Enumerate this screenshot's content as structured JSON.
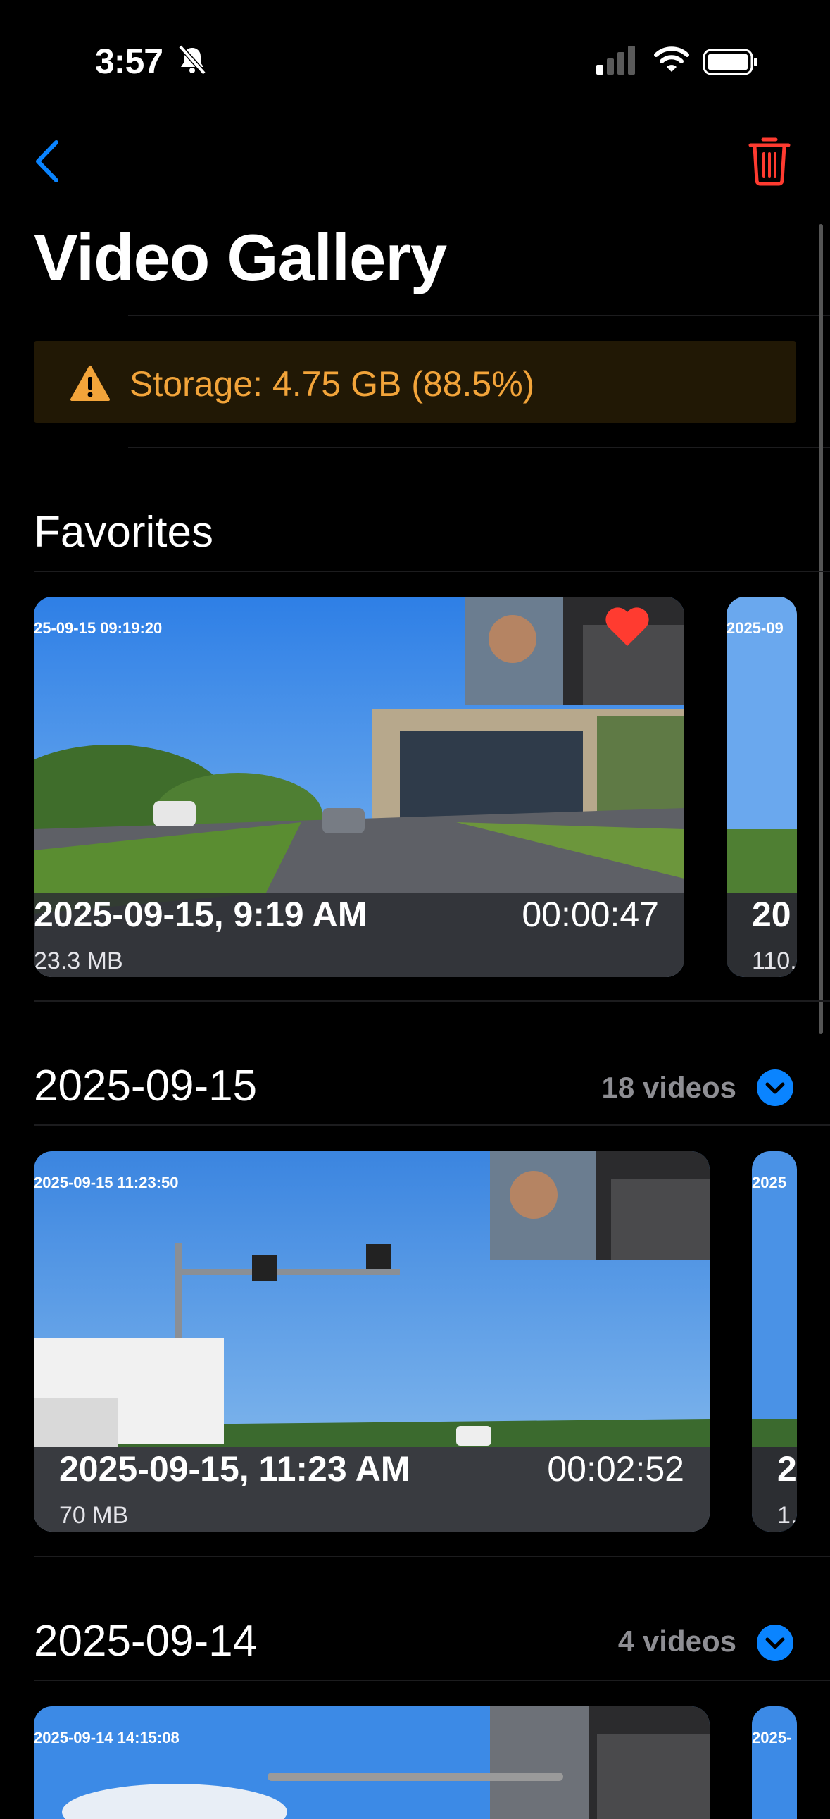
{
  "status_bar": {
    "time": "3:57"
  },
  "nav": {
    "title": "Video Gallery"
  },
  "storage": {
    "text": "Storage: 4.75 GB (88.5%)",
    "accent": "#f2a43a"
  },
  "favorites": {
    "title": "Favorites",
    "cards": [
      {
        "stamp": "25-09-15 09:19:20",
        "date": "2025-09-15, 9:19 AM",
        "duration": "00:00:47",
        "size": "23.3 MB",
        "favorite": true
      },
      {
        "stamp": "2025-09",
        "date": "20",
        "size": "110."
      }
    ]
  },
  "sections": [
    {
      "title": "2025-09-15",
      "count": "18 videos",
      "cards": [
        {
          "stamp": "2025-09-15 11:23:50",
          "date": "2025-09-15, 11:23 AM",
          "duration": "00:02:52",
          "size": "70 MB"
        },
        {
          "stamp": "2025",
          "date": "2",
          "size": "1."
        }
      ]
    },
    {
      "title": "2025-09-14",
      "count": "4 videos",
      "cards": [
        {
          "stamp": "2025-09-14 14:15:08"
        },
        {
          "stamp": "2025-"
        }
      ]
    }
  ]
}
